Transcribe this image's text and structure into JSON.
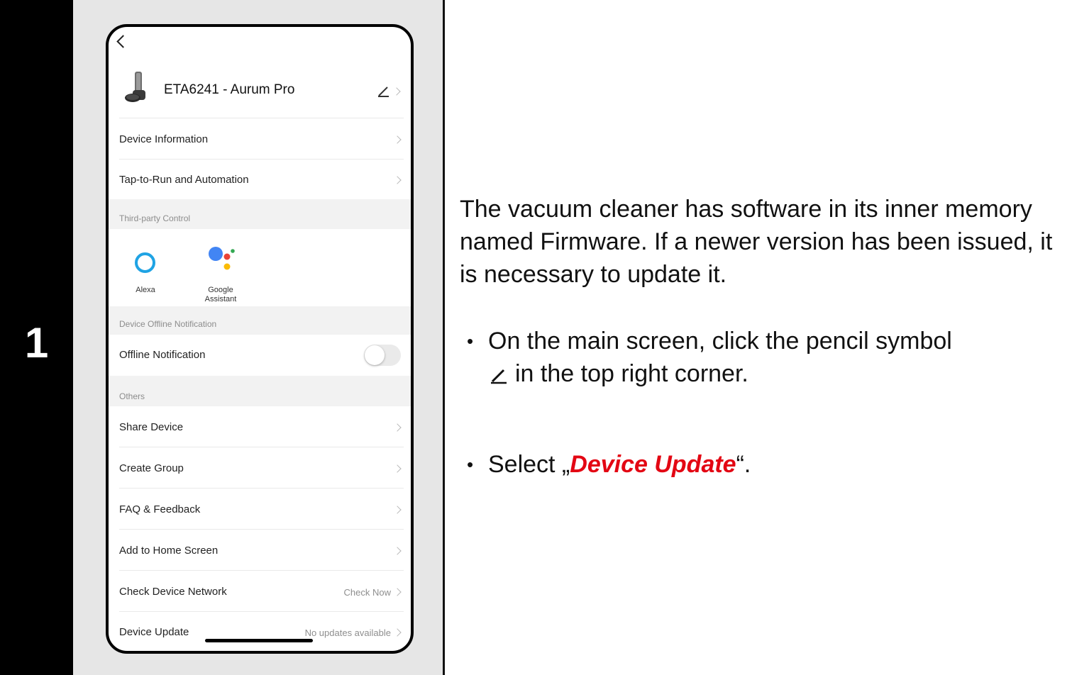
{
  "step": {
    "number": "1"
  },
  "phone": {
    "device_name": "ETA6241 - Aurum Pro",
    "menu_1": [
      {
        "label": "Device Information"
      },
      {
        "label": "Tap-to-Run and Automation"
      }
    ],
    "third_party_header": "Third-party Control",
    "third_party": [
      {
        "label": "Alexa",
        "icon": "alexa-icon"
      },
      {
        "label": "Google Assistant",
        "icon": "google-assistant-icon"
      }
    ],
    "offline_header": "Device Offline Notification",
    "offline_label": "Offline Notification",
    "offline_toggle": false,
    "others_header": "Others",
    "menu_2": [
      {
        "label": "Share Device",
        "value": ""
      },
      {
        "label": "Create Group",
        "value": ""
      },
      {
        "label": "FAQ & Feedback",
        "value": ""
      },
      {
        "label": "Add to Home Screen",
        "value": ""
      },
      {
        "label": "Check Device Network",
        "value": "Check Now"
      },
      {
        "label": "Device Update",
        "value": "No updates available"
      }
    ]
  },
  "instructions": {
    "intro": "The vacuum cleaner has software in its inner memory named Firmware. If a newer version has been issued, it is necessary to update it.",
    "bullet1_line1": "On the main screen, click the pencil symbol",
    "bullet1_line2": "in the top right corner.",
    "bullet2_prefix": "Select „",
    "bullet2_highlight": "Device Update",
    "bullet2_suffix": "“."
  },
  "colors": {
    "accent_red": "#e30613",
    "panel_grey": "#e6e6e6",
    "alexa_blue": "#1fa3e4"
  }
}
